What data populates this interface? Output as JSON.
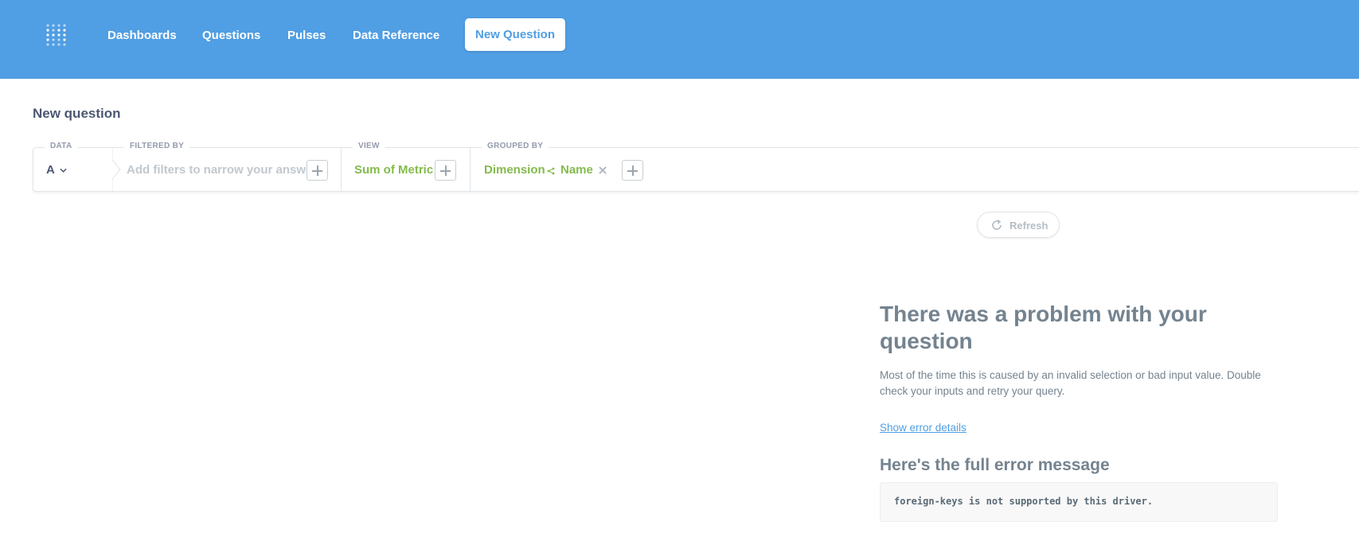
{
  "nav": {
    "links": [
      "Dashboards",
      "Questions",
      "Pulses",
      "Data Reference"
    ],
    "new_question": "New Question",
    "brand_color": "#509ee3",
    "logo_icon": "metabase-logo-icon"
  },
  "page": {
    "title": "New question"
  },
  "query_builder": {
    "data": {
      "label": "DATA",
      "value": "A"
    },
    "filter": {
      "label": "FILTERED BY",
      "placeholder": "Add filters to narrow your answer"
    },
    "view": {
      "label": "VIEW",
      "value": "Sum of Metric"
    },
    "group": {
      "label": "GROUPED BY",
      "dimension": "Dimension",
      "field": "Name"
    },
    "accent_color": "#84bb4c"
  },
  "refresh": {
    "label": "Refresh"
  },
  "error": {
    "title": "There was a problem with your question",
    "description": "Most of the time this is caused by an invalid selection or bad input value. Double check your inputs and retry your query.",
    "details_link": "Show error details",
    "subtitle": "Here's the full error message",
    "message": "foreign-keys is not supported by this driver."
  }
}
